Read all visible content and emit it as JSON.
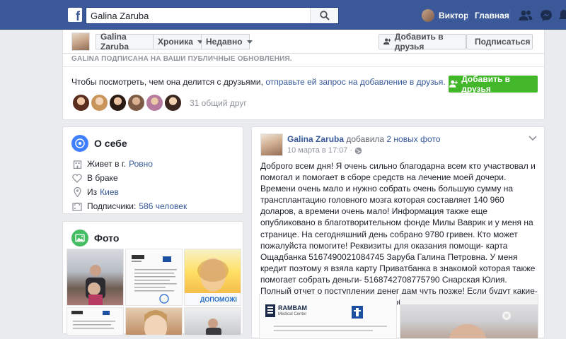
{
  "topbar": {
    "logo": "f",
    "search_value": "Galina Zaruba",
    "user_name": "Виктор",
    "home_label": "Главная",
    "icons": [
      "search-icon",
      "friend-requests-icon",
      "messenger-icon",
      "notifications-icon"
    ],
    "brand_color": "#3b5998"
  },
  "profile_strip": {
    "name": "Galina Zaruba",
    "timeline_label": "Хроника",
    "recent_label": "Недавно",
    "add_friend_label": "Добавить в друзья",
    "follow_label": "Подписаться"
  },
  "notice": {
    "subscribed_text": "GALINA ПОДПИСАНА НА ВАШИ ПУБЛИЧНЫЕ ОБНОВЛЕНИЯ.",
    "prompt_text": "Чтобы посмотреть, чем она делится с друзьями,",
    "prompt_link": "отправьте ей запрос на добавление в друзья.",
    "add_friend_label": "Добавить в друзья",
    "mutual_friends": "31 общий друг",
    "accent_color": "#42b72a"
  },
  "about": {
    "title": "О себе",
    "lives_prefix": "Живет в г.",
    "lives_city": "Ровно",
    "relationship": "В браке",
    "from_prefix": "Из",
    "from_city": "Киев",
    "followers_prefix": "Подписчики:",
    "followers_count": "586 человек"
  },
  "photos": {
    "title": "Фото",
    "photo_caption": "ДОПОМОЖІ"
  },
  "post": {
    "author": "Galina Zaruba",
    "action": "добавила",
    "action_link": "2 новых фото",
    "date": "10 марта в 17:07",
    "privacy_sep": "·",
    "body": "Доброго всем дня! Я очень сильно благодарна всем кто участвовал и помогал и помогает в сборе средств на лечение моей дочери. Времени очень мало и нужно собрать очень большую сумму на трансплантацию головного мозга которая составляет 140 960 доларов, а времени очень мало! Информация также еще опубликовано в благотворительном фонде Милы Ваврик и у меня на странице. На сегодняшний день собрано 9780 гривен. Кто может пожалуйста помогите! Реквизиты для оказания помощи- карта Ощадбанка 5167490021084745 Заруба Галина Петровна. У меня кредит поэтому я взяла карту Приватбанка в знакомой которая также помогает собрать деньги- 5168742708775790 Снарская Юлия. Полный отчет о поступлении денег дам чуть позже! Если будут какие-то вопросы у кого-то, пишите в сообщения!",
    "image_label_1": "RAMBAM",
    "image_label_2": "Medical Center"
  }
}
